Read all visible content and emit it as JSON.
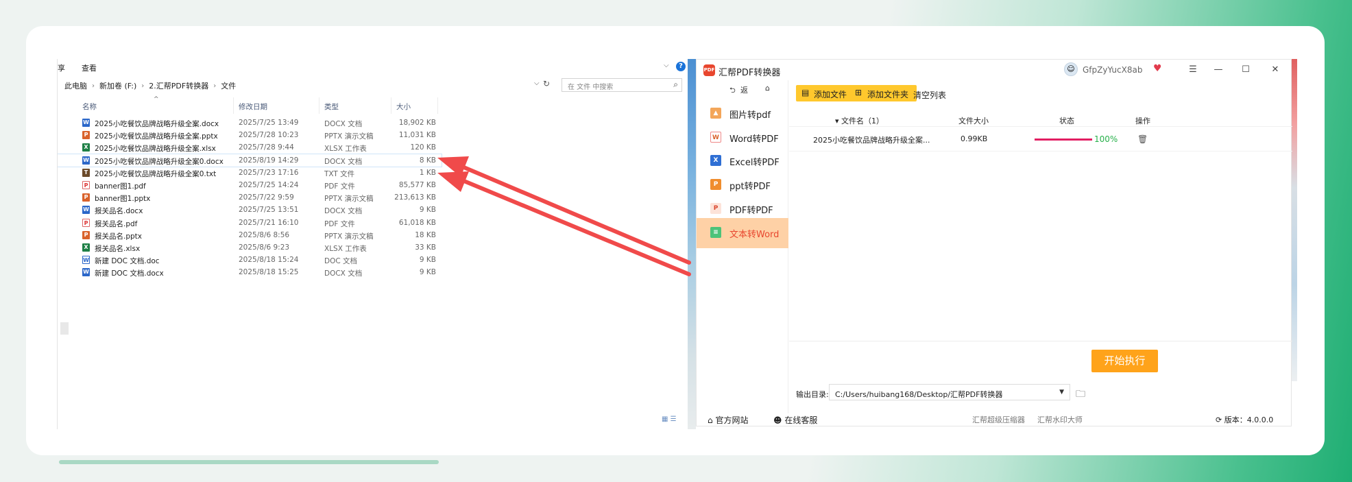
{
  "explorer": {
    "ribbon": {
      "edge_label": "享",
      "view_label": "查看",
      "chevron": "⌵",
      "help": "?"
    },
    "breadcrumbs": [
      "此电脑",
      "新加卷 (F:)",
      "2.汇帮PDF转换器",
      "文件"
    ],
    "breadcrumb_sep": "›",
    "address_dropdown": "⌵",
    "refresh_icon": "↻",
    "search": {
      "placeholder": "在 文件 中搜索",
      "icon": "⌕"
    },
    "columns": {
      "name": "名称",
      "date": "修改日期",
      "type": "类型",
      "size": "大小",
      "sort_caret": "^"
    },
    "files": [
      {
        "icon": "W",
        "icon_class": "ic-w",
        "name": "2025小吃餐饮品牌战略升级全案.docx",
        "date": "2025/7/25 13:49",
        "type": "DOCX 文档",
        "size": "18,902 KB"
      },
      {
        "icon": "P",
        "icon_class": "ic-p",
        "name": "2025小吃餐饮品牌战略升级全案.pptx",
        "date": "2025/7/28 10:23",
        "type": "PPTX 演示文稿",
        "size": "11,031 KB"
      },
      {
        "icon": "X",
        "icon_class": "ic-x",
        "name": "2025小吃餐饮品牌战略升级全案.xlsx",
        "date": "2025/7/28 9:44",
        "type": "XLSX 工作表",
        "size": "120 KB"
      },
      {
        "icon": "W",
        "icon_class": "ic-w",
        "name": "2025小吃餐饮品牌战略升级全案0.docx",
        "date": "2025/8/19 14:29",
        "type": "DOCX 文档",
        "size": "8 KB"
      },
      {
        "icon": "T",
        "icon_class": "ic-t",
        "name": "2025小吃餐饮品牌战略升级全案0.txt",
        "date": "2025/7/23 17:16",
        "type": "TXT 文件",
        "size": "1 KB"
      },
      {
        "icon": "P",
        "icon_class": "ic-pdf",
        "name": "banner图1.pdf",
        "date": "2025/7/25 14:24",
        "type": "PDF 文件",
        "size": "85,577 KB"
      },
      {
        "icon": "P",
        "icon_class": "ic-p",
        "name": "banner图1.pptx",
        "date": "2025/7/22 9:59",
        "type": "PPTX 演示文稿",
        "size": "213,613 KB"
      },
      {
        "icon": "W",
        "icon_class": "ic-w",
        "name": "报关品名.docx",
        "date": "2025/7/25 13:51",
        "type": "DOCX 文档",
        "size": "9 KB"
      },
      {
        "icon": "P",
        "icon_class": "ic-pdf",
        "name": "报关品名.pdf",
        "date": "2025/7/21 16:10",
        "type": "PDF 文件",
        "size": "61,018 KB"
      },
      {
        "icon": "P",
        "icon_class": "ic-p",
        "name": "报关品名.pptx",
        "date": "2025/8/6 8:56",
        "type": "PPTX 演示文稿",
        "size": "18 KB"
      },
      {
        "icon": "X",
        "icon_class": "ic-x",
        "name": "报关品名.xlsx",
        "date": "2025/8/6 9:23",
        "type": "XLSX 工作表",
        "size": "33 KB"
      },
      {
        "icon": "W",
        "icon_class": "ic-doc",
        "name": "新建 DOC 文档.doc",
        "date": "2025/8/18 15:24",
        "type": "DOC 文档",
        "size": "9 KB"
      },
      {
        "icon": "W",
        "icon_class": "ic-w",
        "name": "新建 DOC 文档.docx",
        "date": "2025/8/18 15:25",
        "type": "DOCX 文档",
        "size": "9 KB"
      }
    ],
    "view_icons": "▦ ☰"
  },
  "app": {
    "logo_text": "PDF",
    "title": "汇帮PDF转换器",
    "avatar": "☺",
    "user_name": "GfpZyYucX8ab",
    "vip_icon": "♥",
    "window_buttons": {
      "menu": "☰",
      "minimize": "—",
      "maximize": "☐",
      "close": "✕"
    },
    "back": {
      "arrow": "⮌",
      "label": "返",
      "home": "⌂"
    },
    "nav": [
      {
        "label": "图片转pdf",
        "icon": "▲",
        "icon_class": "ni-img",
        "active": false
      },
      {
        "label": "Word转PDF",
        "icon": "W",
        "icon_class": "ni-word",
        "active": false
      },
      {
        "label": "Excel转PDF",
        "icon": "X",
        "icon_class": "ni-excel",
        "active": false
      },
      {
        "label": "ppt转PDF",
        "icon": "P",
        "icon_class": "ni-ppt",
        "active": false
      },
      {
        "label": "PDF转PDF",
        "icon": "P",
        "icon_class": "ni-pdf",
        "active": false
      },
      {
        "label": "文本转Word",
        "icon": "≡",
        "icon_class": "ni-txt",
        "active": true
      }
    ],
    "toolbar": {
      "add_file": "添加文件",
      "add_file_icon": "▤",
      "add_folder": "添加文件夹",
      "add_folder_icon": "⊞",
      "clear": "清空列表"
    },
    "table": {
      "headers": {
        "name": "▾ 文件名（1）",
        "size": "文件大小",
        "status": "状态",
        "op": "操作"
      },
      "rows": [
        {
          "name": "2025小吃餐饮品牌战略升级全案...",
          "size": "0.99KB",
          "progress": 1.0,
          "percent": "100%",
          "delete_icon": "🗑"
        }
      ]
    },
    "output": {
      "label": "输出目录:",
      "path": "C:/Users/huibang168/Desktop/汇帮PDF转换器",
      "dropdown": "▼",
      "folder_icon": "🗀"
    },
    "start_button": "开始执行",
    "bottom": {
      "site": "官方网站",
      "site_icon": "⌂",
      "service": "在线客服",
      "service_icon": "☻",
      "compress": "汇帮超级压缩器",
      "watermark": "汇帮水印大师",
      "version_icon": "⟳",
      "version": "版本：4.0.0.0"
    }
  },
  "colors": {
    "accent_yellow": "#ffc82d",
    "start_orange": "#ffa31a",
    "active_nav_bg": "#fed1a6",
    "active_nav_text": "#e8462e",
    "progress": "#e21d62",
    "percent_green": "#27b04a",
    "arrow_red": "#f04a4a"
  }
}
